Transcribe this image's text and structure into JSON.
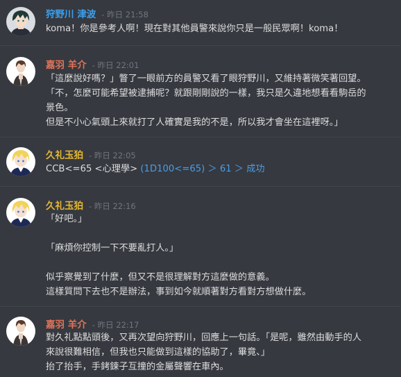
{
  "messages": [
    {
      "author": "狩野川 津波",
      "author_color": "#3aa0f0",
      "sep": "-",
      "time": "昨日 21:58",
      "avatar_icon": "dark-haired-character-avatar",
      "lines": [
        "koma！你是參考人啊！現在對其他員警來說你只是一般民眾啊！koma！"
      ]
    },
    {
      "author": "嘉羽 羊介",
      "author_color": "#e0745a",
      "sep": "-",
      "time": "昨日 22:01",
      "avatar_icon": "brown-haired-character-avatar",
      "lines": [
        "「這麼說好嗎？」瞥了一眼前方的員警又看了眼狩野川，又維持著微笑著回望。",
        "「不，怎麼可能希望被逮捕呢？就跟剛剛說的一樣，我只是久違地想看看駒岳的",
        "景色。",
        "但是不小心氣頭上來就打了人確實是我的不是，所以我才會坐在這裡呀。」"
      ]
    },
    {
      "author": "久礼玉狛",
      "author_color": "#e6b832",
      "sep": "-",
      "time": "昨日 22:05",
      "avatar_icon": "blonde-character-avatar",
      "roll": {
        "command": "CCB<=65 <心理學>",
        "result": "(1D100<=65) ＞ 61 ＞ 成功"
      }
    },
    {
      "author": "久礼玉狛",
      "author_color": "#e6b832",
      "sep": "-",
      "time": "昨日 22:16",
      "avatar_icon": "blonde-character-avatar",
      "lines": [
        "「好吧。」",
        "",
        "「麻煩你控制一下不要亂打人。」",
        "",
        "似乎察覺到了什麼，但又不是很理解對方這麼做的意義。",
        "這樣質問下去也不是辦法，事到如今就順著對方看對方想做什麼。"
      ]
    },
    {
      "author": "嘉羽 羊介",
      "author_color": "#e0745a",
      "sep": "-",
      "time": "昨日 22:17",
      "avatar_icon": "brown-haired-character-avatar",
      "lines": [
        "對久礼點點頭後，又再次望向狩野川，回應上一句話。「是呢，雖然由動手的人",
        "來說很難相信，但我也只能做到這樣的協助了，畢竟、」",
        "抬了抬手，手銬鍊子互撞的金屬聲響在車內。"
      ]
    }
  ]
}
